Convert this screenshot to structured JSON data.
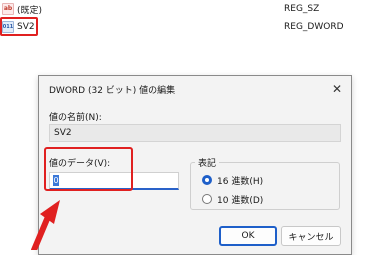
{
  "registry": {
    "rows": [
      {
        "icon": "ab",
        "name": "(既定)",
        "type": "REG_SZ"
      },
      {
        "icon": "bin",
        "name": "SV2",
        "type": "REG_DWORD"
      }
    ]
  },
  "dialog": {
    "title": "DWORD (32 ビット) 値の編集",
    "close_glyph": "✕",
    "value_name_label": "値の名前(N):",
    "value_name": "SV2",
    "value_data_label": "値のデータ(V):",
    "value_data": "0",
    "base_label": "表記",
    "base_options": [
      {
        "label": "16 進数(H)",
        "selected": true
      },
      {
        "label": "10 進数(D)",
        "selected": false
      }
    ],
    "ok_label": "OK",
    "cancel_label": "キャンセル"
  },
  "annotation": {
    "highlight_color": "#e02020"
  }
}
